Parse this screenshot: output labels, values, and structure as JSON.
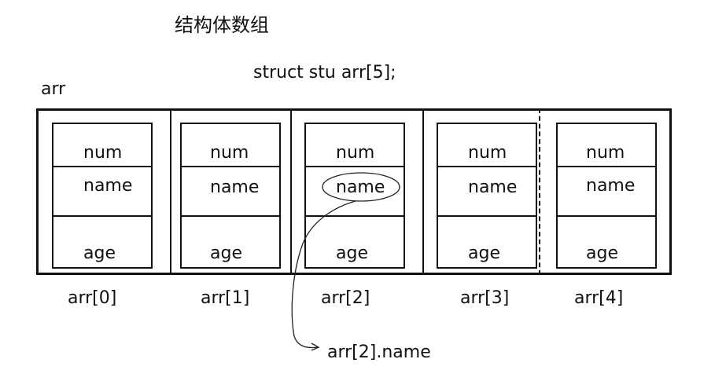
{
  "title": "结构体数组",
  "declaration": "struct stu arr[5];",
  "array_label": "arr",
  "fields": [
    "num",
    "name",
    "age"
  ],
  "elements": [
    {
      "index_label": "arr[0]"
    },
    {
      "index_label": "arr[1]"
    },
    {
      "index_label": "arr[2]"
    },
    {
      "index_label": "arr[3]"
    },
    {
      "index_label": "arr[4]"
    }
  ],
  "highlight": {
    "element": 2,
    "field": "name",
    "label": "arr[2].name"
  }
}
